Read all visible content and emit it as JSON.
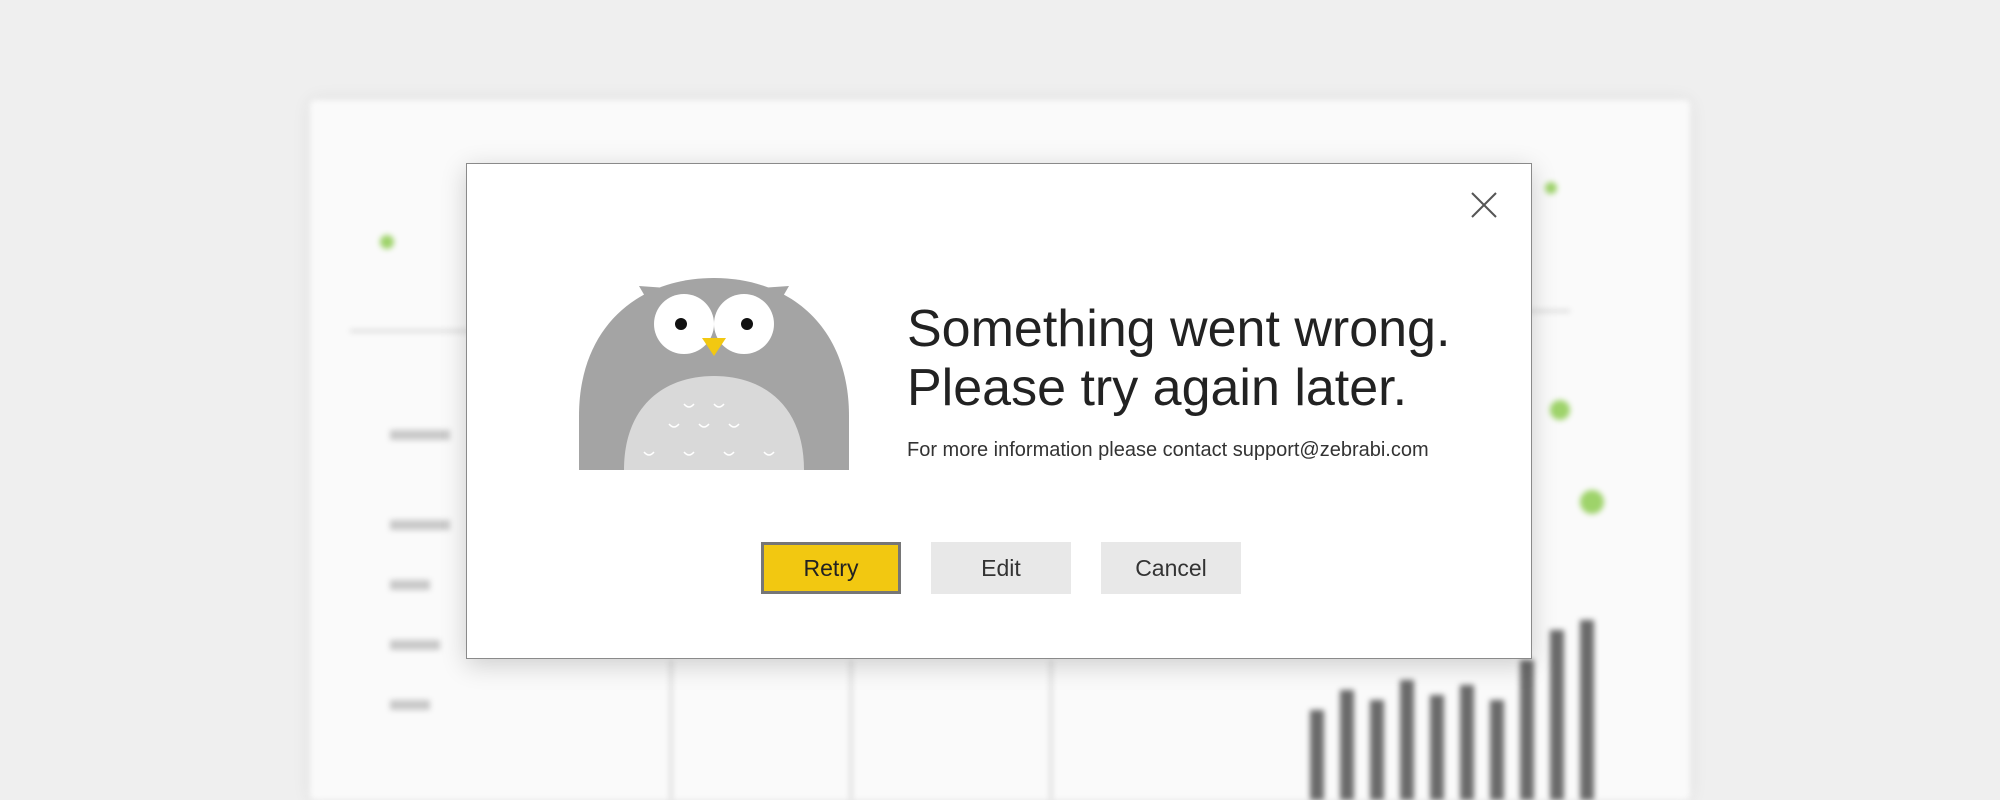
{
  "dialog": {
    "title_line1": "Something went wrong.",
    "title_line2": "Please try again later.",
    "subtitle": "For more information please contact support@zebrabi.com",
    "retry_label": "Retry",
    "edit_label": "Edit",
    "cancel_label": "Cancel"
  },
  "colors": {
    "primary_button": "#f2c811",
    "owl_body": "#a4a4a4",
    "owl_belly": "#d9d9d9",
    "owl_beak": "#f2c811"
  },
  "icons": {
    "close": "close-icon",
    "illustration": "owl-illustration"
  }
}
